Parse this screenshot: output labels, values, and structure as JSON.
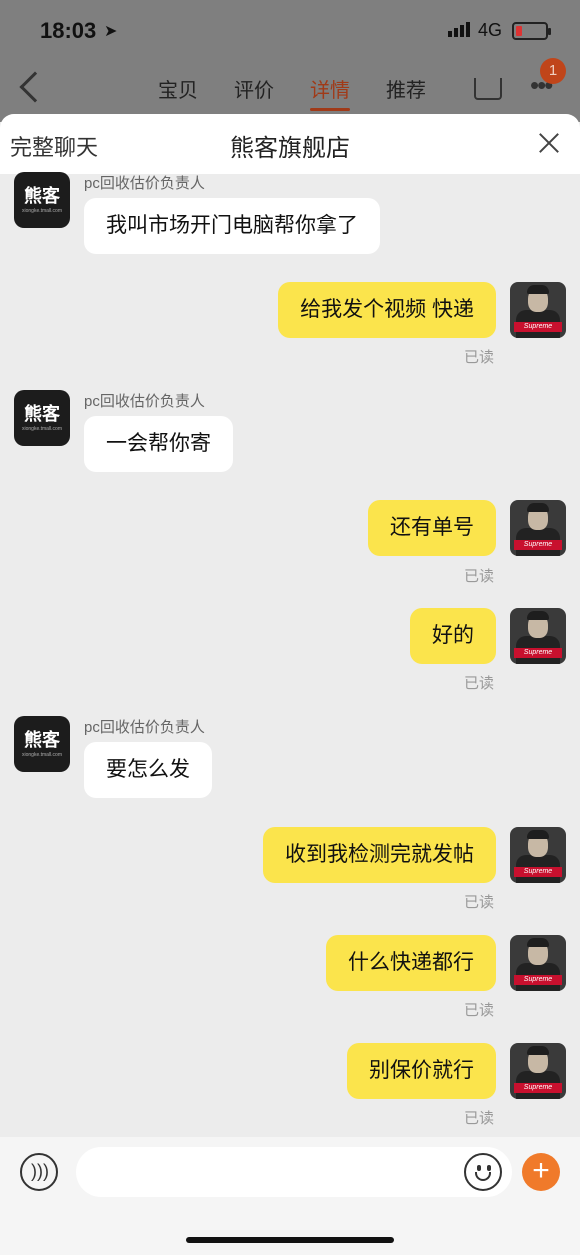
{
  "status_bar": {
    "time": "18:03",
    "network": "4G"
  },
  "background_nav": {
    "tabs": [
      {
        "label": "宝贝"
      },
      {
        "label": "评价"
      },
      {
        "label": "详情"
      },
      {
        "label": "推荐"
      }
    ],
    "active_tab": "详情",
    "badge_count": "1"
  },
  "chat": {
    "full_chat_label": "完整聊天",
    "title": "熊客旗舰店",
    "shop_avatar_text": "熊客",
    "shop_avatar_subtext": "xiongke.tmall.com",
    "my_avatar_label": "Supreme",
    "messages": [
      {
        "direction": "in",
        "sender": "pc回收估价负责人",
        "text": "我叫市场开门电脑帮你拿了"
      },
      {
        "direction": "out",
        "text": "给我发个视频 快递",
        "status": "已读"
      },
      {
        "direction": "in",
        "sender": "pc回收估价负责人",
        "text": "一会帮你寄"
      },
      {
        "direction": "out",
        "text": "还有单号",
        "status": "已读"
      },
      {
        "direction": "out",
        "text": "好的",
        "status": "已读"
      },
      {
        "direction": "in",
        "sender": "pc回收估价负责人",
        "text": "要怎么发"
      },
      {
        "direction": "out",
        "text": "收到我检测完就发帖",
        "status": "已读"
      },
      {
        "direction": "out",
        "text": "什么快递都行",
        "status": "已读"
      },
      {
        "direction": "out",
        "text": "别保价就行",
        "status": "已读"
      }
    ]
  },
  "input": {
    "value": "",
    "placeholder": ""
  },
  "colors": {
    "outgoing_bubble": "#fbe44c",
    "incoming_bubble": "#ffffff",
    "accent": "#f07a2a"
  }
}
